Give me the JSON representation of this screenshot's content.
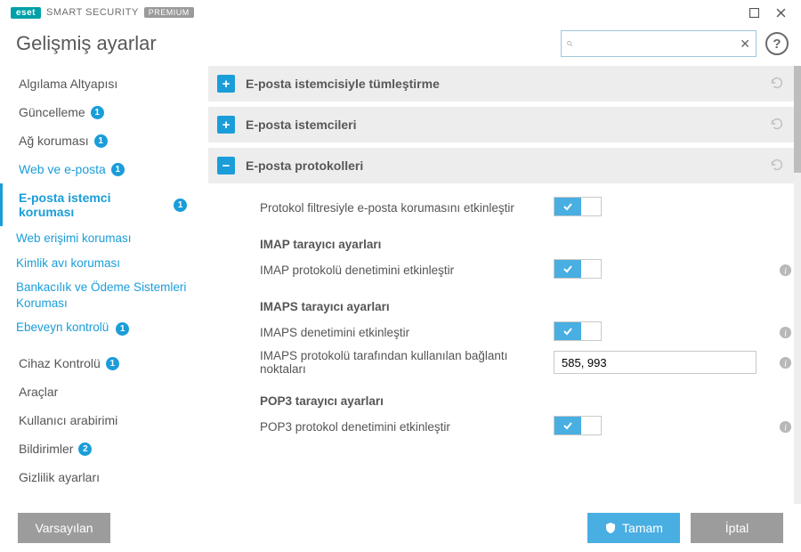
{
  "brand": {
    "eset": "eset",
    "product": "SMART SECURITY",
    "edition": "PREMIUM"
  },
  "page_title": "Gelişmiş ayarlar",
  "search": {
    "placeholder": "",
    "value": ""
  },
  "help_label": "?",
  "sidebar": {
    "items": [
      {
        "label": "Algılama Altyapısı",
        "link": false,
        "badge": null
      },
      {
        "label": "Güncelleme",
        "link": false,
        "badge": "1"
      },
      {
        "label": "Ağ koruması",
        "link": false,
        "badge": "1"
      },
      {
        "label": "Web ve e-posta",
        "link": true,
        "badge": "1"
      },
      {
        "label": "E-posta istemci koruması",
        "link": true,
        "badge": "1",
        "active": true
      },
      {
        "label": "Cihaz Kontrolü",
        "link": false,
        "badge": "1"
      },
      {
        "label": "Araçlar",
        "link": false,
        "badge": null
      },
      {
        "label": "Kullanıcı arabirimi",
        "link": false,
        "badge": null
      },
      {
        "label": "Bildirimler",
        "link": false,
        "badge": "2"
      },
      {
        "label": "Gizlilik ayarları",
        "link": false,
        "badge": null
      }
    ],
    "subitems": [
      "Web erişimi koruması",
      "Kimlik avı koruması",
      "Bankacılık ve Ödeme Sistemleri Koruması",
      "Ebeveyn kontrolü"
    ],
    "sub_badge": "1"
  },
  "sections": [
    {
      "title": "E-posta istemcisiyle tümleştirme",
      "expanded": false
    },
    {
      "title": "E-posta istemcileri",
      "expanded": false
    },
    {
      "title": "E-posta protokolleri",
      "expanded": true
    }
  ],
  "protocols": {
    "enable_filter_label": "Protokol filtresiyle e-posta korumasını etkinleştir",
    "imap": {
      "heading": "IMAP tarayıcı ayarları",
      "enable_label": "IMAP protokolü denetimini etkinleştir"
    },
    "imaps": {
      "heading": "IMAPS tarayıcı ayarları",
      "enable_label": "IMAPS denetimini etkinleştir",
      "ports_label": "IMAPS protokolü tarafından kullanılan bağlantı noktaları",
      "ports_value": "585, 993"
    },
    "pop3": {
      "heading": "POP3 tarayıcı ayarları",
      "enable_label": "POP3 protokol denetimini etkinleştir"
    }
  },
  "footer": {
    "default": "Varsayılan",
    "ok": "Tamam",
    "cancel": "İptal"
  }
}
